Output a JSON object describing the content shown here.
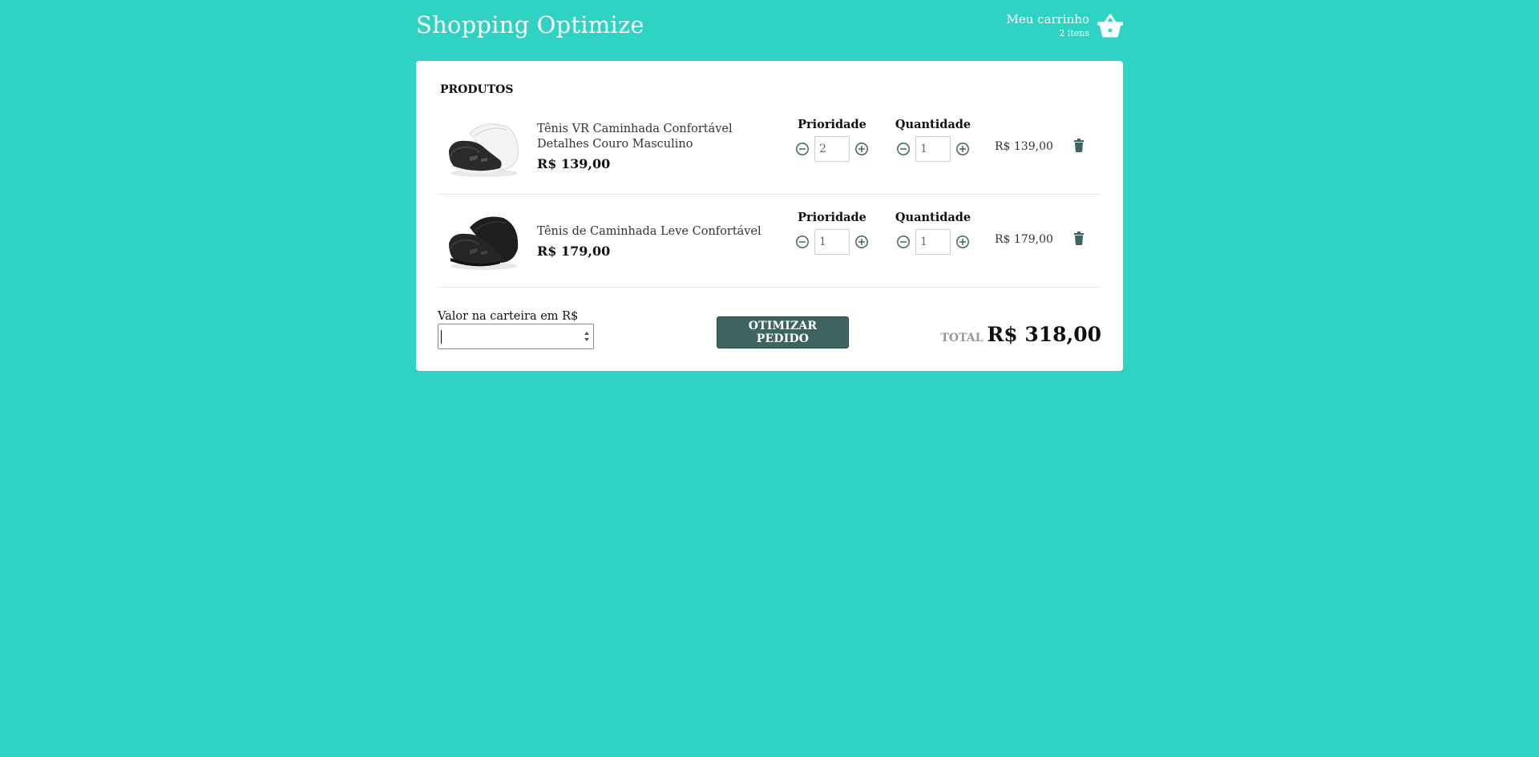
{
  "header": {
    "title": "Shopping Optimize",
    "cart_title": "Meu carrinho",
    "cart_count": "2 itens"
  },
  "products": {
    "section_title": "PRODUTOS",
    "priority_label": "Prioridade",
    "quantity_label": "Quantidade",
    "items": [
      {
        "name": "Tênis VR Caminhada Confortável Detalhes Couro Masculino",
        "price": "R$ 139,00",
        "priority": "2",
        "quantity": "1",
        "line_total": "R$ 139,00"
      },
      {
        "name": "Tênis de Caminhada Leve Confortável",
        "price": "R$ 179,00",
        "priority": "1",
        "quantity": "1",
        "line_total": "R$ 179,00"
      }
    ]
  },
  "footer": {
    "wallet_label": "Valor na carteira em R$",
    "wallet_value": "",
    "optimize_label": "OTIMIZAR PEDIDO",
    "total_label": "TOTAL",
    "total_value": "R$ 318,00"
  },
  "colors": {
    "background": "#2fd3c3",
    "accent": "#3e6461"
  }
}
